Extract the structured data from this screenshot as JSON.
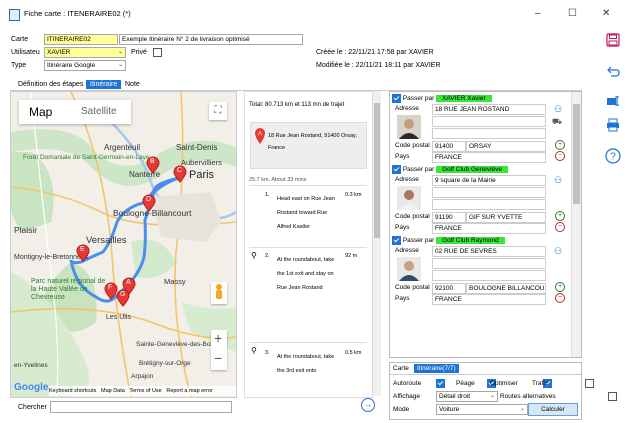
{
  "window": {
    "title": "Fiche carte : ITENERAIRE02 (*)",
    "minimize": "–",
    "maximize": "☐",
    "close": "✕"
  },
  "form": {
    "carte_label": "Carte",
    "carte_value": "ITINERAIRE02",
    "carte_desc": "Exemple Itinéraire N° 2 de livraison optimisé",
    "utilisateur_label": "Utilisateu",
    "utilisateur_value": "XAVIER",
    "prive_label": "Privé",
    "type_label": "Type",
    "type_value": "Itinéraire Google",
    "created": "Créée le : 22/11/21 17:58 par XAVIER",
    "modified": "Modifiée le : 22/11/21 18:11 par XAVIER"
  },
  "tabs": [
    "Définition des étapes",
    "Itinéraire",
    "Note"
  ],
  "map": {
    "map_btn": "Map",
    "satellite_btn": "Satellite",
    "labels": [
      "Forêt Domaniale de Saint-Germain-en-Laye",
      "Argenteuil",
      "Saint-Denis",
      "Aubervilliers",
      "Nanterre",
      "Paris",
      "Boulogne-Billancourt",
      "Plaisir",
      "Versailles",
      "Montigny-le-Bretonneux",
      "Parc naturel régional de la Haute Vallée de Chevreuse",
      "Massy",
      "Les Ulis",
      "Sainte-Geneviève-des-Bois",
      "Brétigny-sur-Orge",
      "Arpajon",
      "en-Yvelines"
    ],
    "markers": [
      "A",
      "B",
      "C",
      "D",
      "E",
      "F",
      "G"
    ],
    "footer": [
      "Keyboard shortcuts",
      "Map Data",
      "Terms of Use",
      "Report a map error"
    ],
    "google": "Google",
    "zoom_in": "+",
    "zoom_out": "−"
  },
  "route": {
    "total": "Total: 80.713 km et 113 mn de trajet",
    "start_address": "18 Rue Jean Rostand, 91400 Orsay, France",
    "segment": "25.7 km. About 33 mins",
    "steps": [
      {
        "num": "1.",
        "text": "Head east on Rue Jean Rostand toward Rue Alfred Kastler",
        "dist": "0.3 km"
      },
      {
        "num": "2.",
        "text": "At the roundabout, take the 1st exit and stay on Rue Jean Rostand",
        "dist": "92 m"
      },
      {
        "num": "3.",
        "text": "At the roundabout, take the 3rd exit onto",
        "dist": "0.5 km"
      }
    ]
  },
  "stops": [
    {
      "passer": "Passer par",
      "name": "XAVIER Xavier",
      "adresse_label": "Adresse",
      "adresse": "18 RUE JEAN ROSTAND",
      "cp_label": "Code postal",
      "cp": "91400",
      "ville": "ORSAY",
      "pays_label": "Pays",
      "pays": "FRANCE"
    },
    {
      "passer": "Passer par",
      "name": "Golf Club Geneviève",
      "adresse_label": "Adresse",
      "adresse": "9 square de la Mairie",
      "cp_label": "Code postal",
      "cp": "91190",
      "ville": "GIF SUR YVETTE",
      "pays_label": "Pays",
      "pays": "FRANCE"
    },
    {
      "passer": "Passer par",
      "name": "Golf Club Raymond",
      "adresse_label": "Adresse",
      "adresse": "02 RUE DE SEVRES",
      "cp_label": "Code postal",
      "cp": "92100",
      "ville": "BOULOGNE BILLANCOURT",
      "pays_label": "Pays",
      "pays": "FRANCE"
    }
  ],
  "bottom_tabs": [
    "Carte",
    "Itinéraire(7/7)"
  ],
  "options": {
    "autoroute": "Autoroute",
    "peage": "Péage",
    "optimiser": "Optimiser",
    "trafic": "Trafic",
    "affichage_label": "Affichage",
    "affichage_value": "Détail droit",
    "routes_alt": "Routes alternatives",
    "mode_label": "Mode",
    "mode_value": "Voiture",
    "calculer": "Calculer"
  },
  "search": {
    "label": "Chercher"
  },
  "colors": {
    "accent": "#1e73d6",
    "marker": "#e53935",
    "badge": "#39e639",
    "yellow": "#ffff99"
  }
}
